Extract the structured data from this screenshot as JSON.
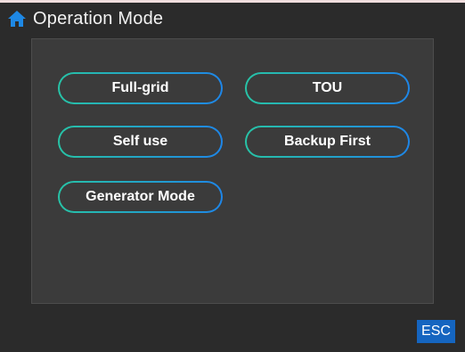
{
  "header": {
    "title": "Operation Mode",
    "icon": "home-icon"
  },
  "modes": [
    {
      "label": "Full-grid"
    },
    {
      "label": "TOU"
    },
    {
      "label": "Self use"
    },
    {
      "label": "Backup First"
    },
    {
      "label": "Generator Mode"
    }
  ],
  "footer": {
    "esc_label": "ESC"
  },
  "colors": {
    "background": "#2b2b2b",
    "panel": "#3b3b3b",
    "border_gradient_start": "#27c3a6",
    "border_gradient_end": "#1e86e8",
    "esc_bg": "#1565c0",
    "home_icon": "#1e88e5"
  }
}
